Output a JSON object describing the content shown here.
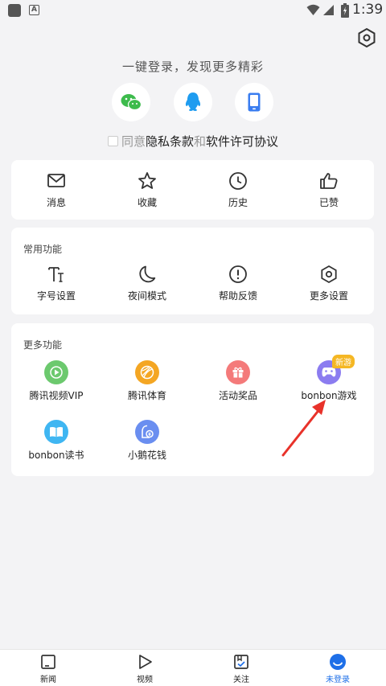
{
  "status_bar": {
    "time": "1:39",
    "icons": [
      "app-square-icon",
      "a-notification-icon",
      "wifi-icon",
      "signal-icon",
      "battery-icon"
    ]
  },
  "header": {
    "settings_icon": "hexagon-settings-icon"
  },
  "login": {
    "title": "一键登录，发现更多精彩",
    "methods": [
      {
        "name": "wechat",
        "icon": "wechat-icon",
        "color": "#3dbb4c"
      },
      {
        "name": "qq",
        "icon": "qq-icon",
        "color": "#1e9cf0"
      },
      {
        "name": "phone",
        "icon": "phone-icon",
        "color": "#3a7df0"
      }
    ],
    "agree_prefix": "同意",
    "privacy_link": "隐私条款",
    "agree_and": "和",
    "license_link": "软件许可协议"
  },
  "quick_actions": [
    {
      "label": "消息",
      "icon": "message-icon"
    },
    {
      "label": "收藏",
      "icon": "star-icon"
    },
    {
      "label": "历史",
      "icon": "clock-icon"
    },
    {
      "label": "已赞",
      "icon": "thumbs-up-icon"
    }
  ],
  "common": {
    "title": "常用功能",
    "items": [
      {
        "label": "字号设置",
        "icon": "font-size-icon"
      },
      {
        "label": "夜间模式",
        "icon": "moon-icon"
      },
      {
        "label": "帮助反馈",
        "icon": "help-icon"
      },
      {
        "label": "更多设置",
        "icon": "settings-icon"
      }
    ]
  },
  "more": {
    "title": "更多功能",
    "items": [
      {
        "label": "腾讯视频VIP",
        "icon": "tencent-video-icon",
        "color": "#6cc96e"
      },
      {
        "label": "腾讯体育",
        "icon": "sports-ball-icon",
        "color": "#f4a623"
      },
      {
        "label": "活动奖品",
        "icon": "gift-icon",
        "color": "#f47a7a"
      },
      {
        "label": "bonbon游戏",
        "icon": "gamepad-icon",
        "color": "#8b7cf0",
        "badge": "新游"
      },
      {
        "label": "bonbon读书",
        "icon": "book-icon",
        "color": "#3fb6f2"
      },
      {
        "label": "小鹅花钱",
        "icon": "wallet-icon",
        "color": "#6a8ef0"
      }
    ]
  },
  "bottom_nav": [
    {
      "label": "新闻",
      "icon": "news-icon"
    },
    {
      "label": "视频",
      "icon": "play-icon"
    },
    {
      "label": "关注",
      "icon": "follow-icon"
    },
    {
      "label": "未登录",
      "icon": "profile-icon",
      "active": true
    }
  ],
  "colors": {
    "accent": "#1e6fe8",
    "annotation_arrow": "#e8322a",
    "badge": "#f5b724"
  }
}
